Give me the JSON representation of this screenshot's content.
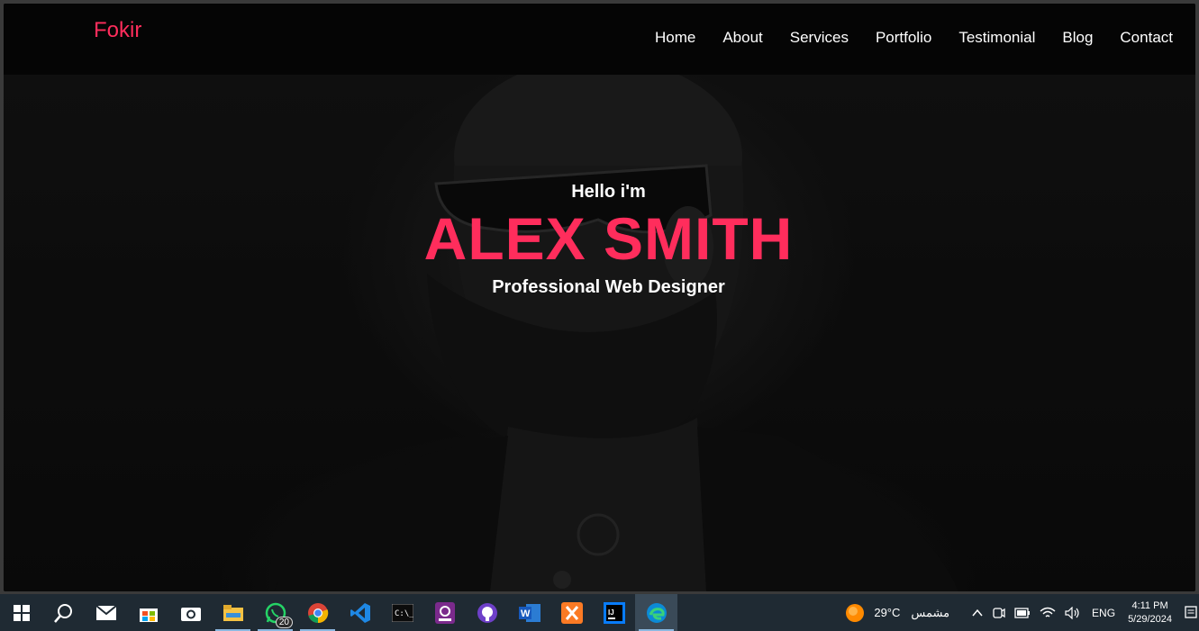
{
  "site": {
    "logo": "Fokir",
    "nav": [
      "Home",
      "About",
      "Services",
      "Portfolio",
      "Testimonial",
      "Blog",
      "Contact"
    ],
    "hero": {
      "greeting": "Hello i'm",
      "name": "ALEX SMITH",
      "role": "Professional Web Designer"
    },
    "colors": {
      "accent": "#ff2d5c",
      "background": "#0b0b0b",
      "nav_text": "#ffffff"
    }
  },
  "taskbar": {
    "apps": [
      {
        "icon": "start-icon"
      },
      {
        "icon": "search-icon"
      },
      {
        "icon": "mail-icon"
      },
      {
        "icon": "store-icon"
      },
      {
        "icon": "camera-icon"
      },
      {
        "icon": "file-explorer-icon"
      },
      {
        "icon": "whatsapp-icon",
        "badge": "20"
      },
      {
        "icon": "chrome-icon"
      },
      {
        "icon": "vscode-icon"
      },
      {
        "icon": "terminal-icon"
      },
      {
        "icon": "pdf-icon"
      },
      {
        "icon": "github-icon"
      },
      {
        "icon": "word-icon"
      },
      {
        "icon": "xampp-icon"
      },
      {
        "icon": "intellij-icon"
      },
      {
        "icon": "edge-icon"
      }
    ],
    "weather": {
      "temp": "29°C",
      "condition": "مشمس"
    },
    "language": "ENG",
    "time": "4:11 PM",
    "date": "5/29/2024"
  }
}
